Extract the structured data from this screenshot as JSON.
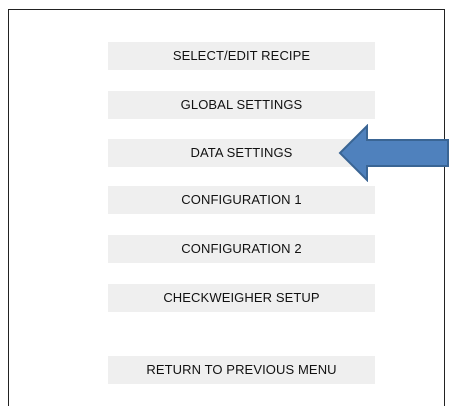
{
  "menu": {
    "items": [
      {
        "id": "select-edit-recipe",
        "label": "SELECT/EDIT RECIPE"
      },
      {
        "id": "global-settings",
        "label": "GLOBAL SETTINGS"
      },
      {
        "id": "data-settings",
        "label": "DATA SETTINGS"
      },
      {
        "id": "configuration-1",
        "label": "CONFIGURATION 1"
      },
      {
        "id": "configuration-2",
        "label": "CONFIGURATION 2"
      },
      {
        "id": "checkweigher-setup",
        "label": "CHECKWEIGHER SETUP"
      },
      {
        "id": "return-previous",
        "label": "RETURN TO PREVIOUS MENU"
      }
    ]
  },
  "pointer": {
    "icon": "left-arrow-icon",
    "fill_color": "#4f81bd",
    "stroke_color": "#3a6594",
    "points_to": "DATA SETTINGS"
  },
  "colors": {
    "button_bg": "#efefef",
    "frame_border": "#222222"
  }
}
